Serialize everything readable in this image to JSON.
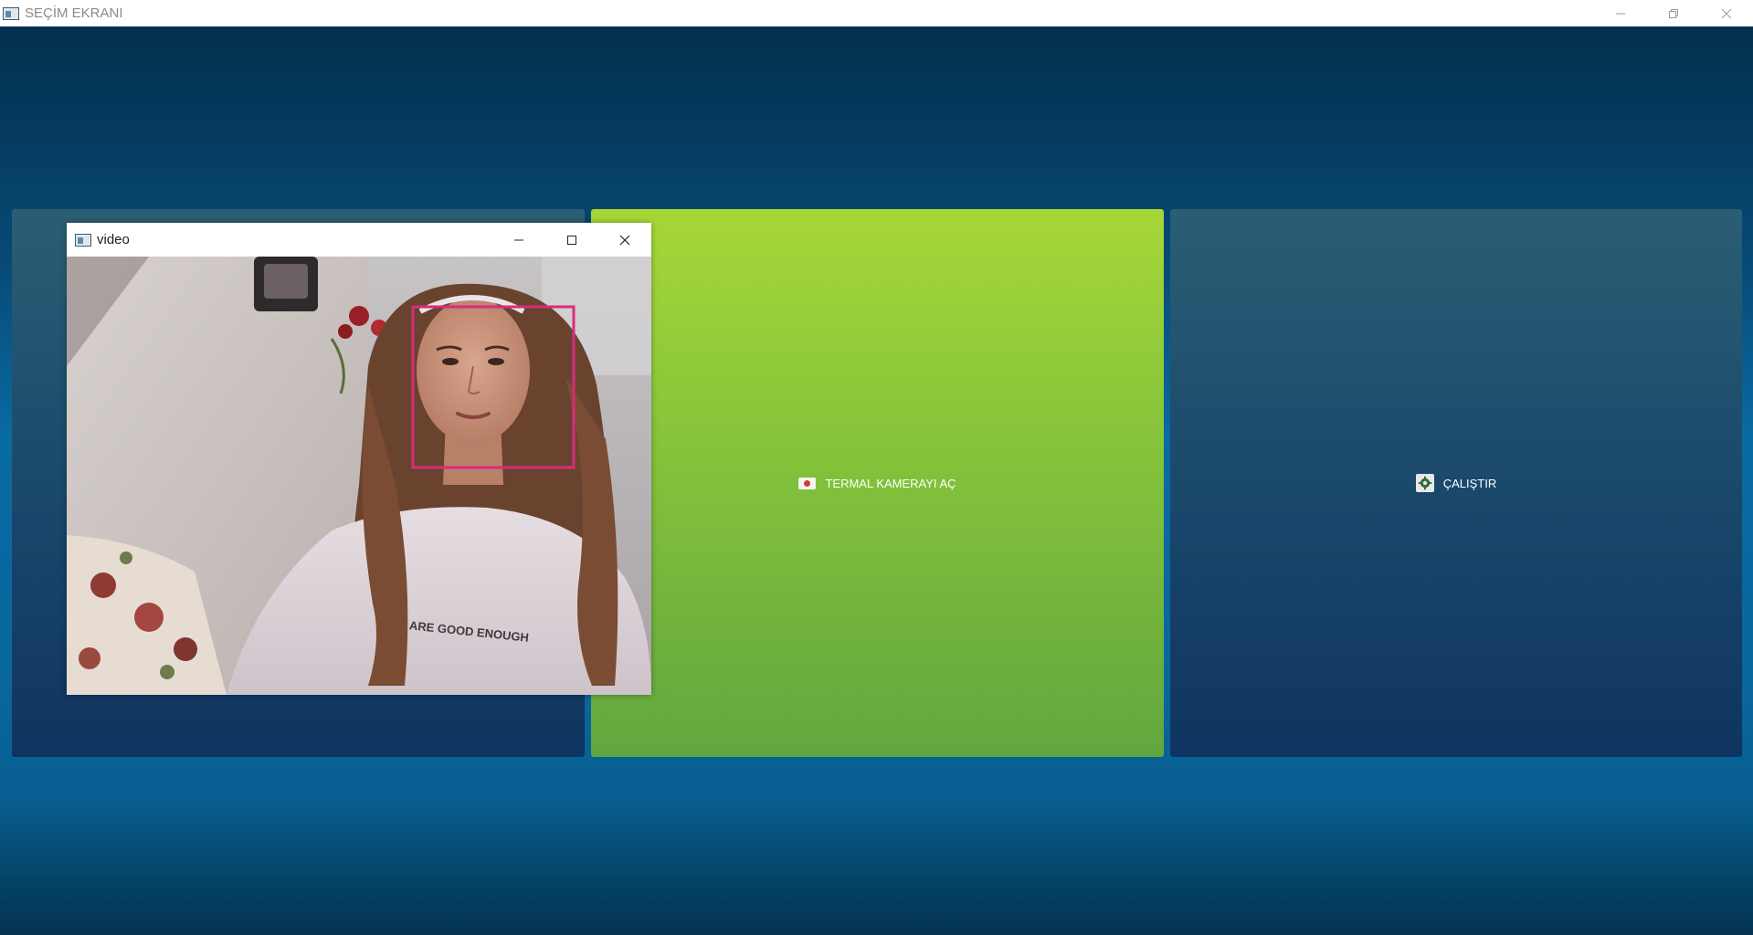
{
  "window": {
    "title": "SEÇİM EKRANI",
    "controls": [
      "minimize-icon",
      "restore-icon",
      "close-icon"
    ]
  },
  "buttons": {
    "thermal_camera": {
      "label": "TERMAL KAMERAYI AÇ",
      "icon": "camera-icon"
    },
    "run": {
      "label": "ÇALIŞTIR",
      "icon": "gear-icon"
    }
  },
  "video_window": {
    "title": "video",
    "controls": [
      "minimize-icon",
      "maximize-icon",
      "close-icon"
    ],
    "shirt_text": "ARE GOOD ENOUGH"
  },
  "colors": {
    "accent_green": "#a6d737",
    "panel_blue": "#1d4d6d",
    "face_box": "#d82c7c"
  }
}
